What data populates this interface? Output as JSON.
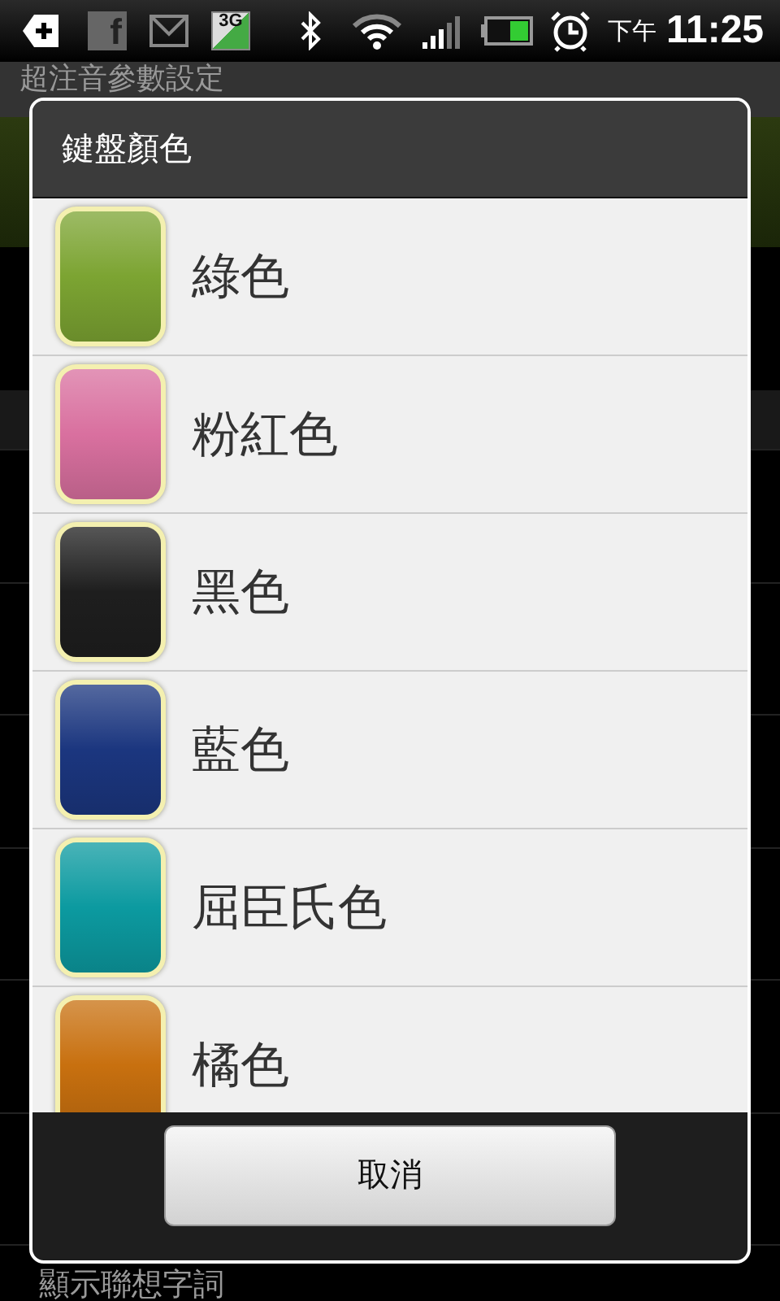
{
  "status_bar": {
    "facebook_label": "f",
    "network_label": "3G",
    "period": "下午",
    "time": "11:25"
  },
  "background": {
    "title": "超注音參數設定",
    "items": [
      "顯示聯想字詞"
    ]
  },
  "dialog": {
    "title": "鍵盤顏色",
    "options": [
      {
        "label": "綠色",
        "color": "#7ca432"
      },
      {
        "label": "粉紅色",
        "color": "#d9709f"
      },
      {
        "label": "黑色",
        "color": "#1e1e1e"
      },
      {
        "label": "藍色",
        "color": "#1b367f"
      },
      {
        "label": "屈臣氏色",
        "color": "#0c9aa0"
      },
      {
        "label": "橘色",
        "color": "#c8700f"
      }
    ],
    "buttons": [
      "取消"
    ]
  }
}
